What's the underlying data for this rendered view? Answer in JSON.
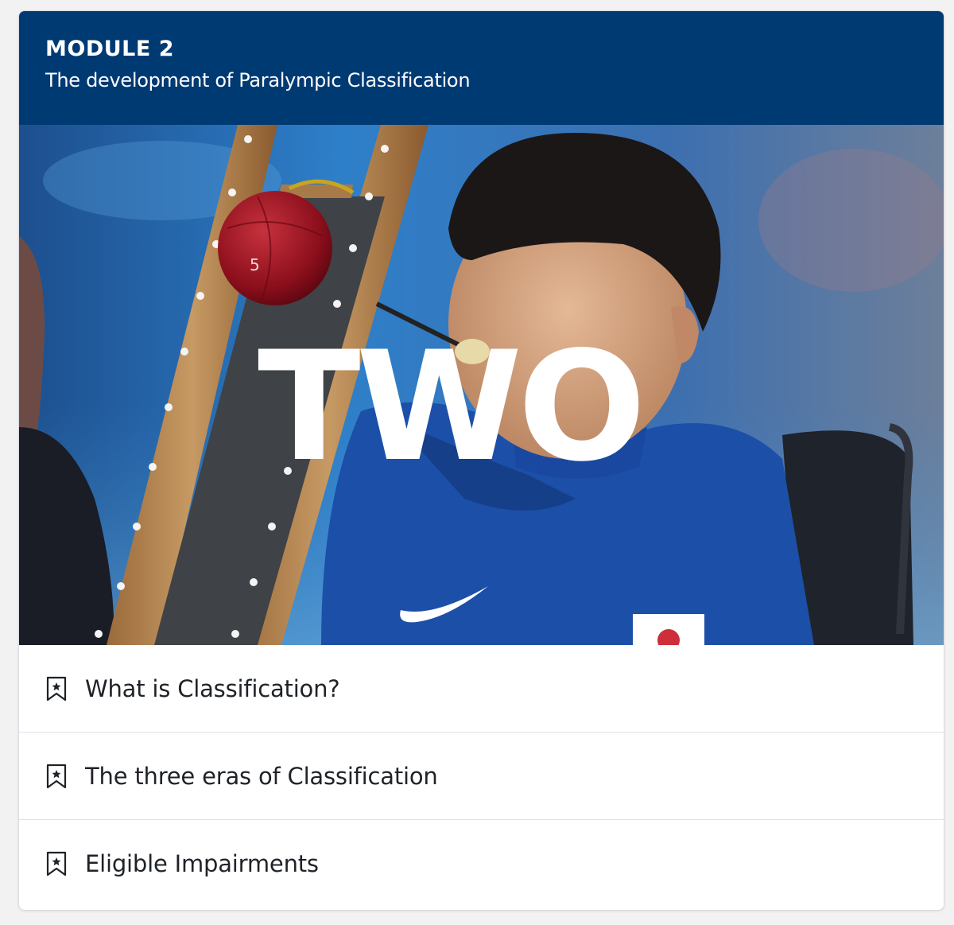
{
  "module": {
    "label": "MODULE 2",
    "subtitle": "The development of Paralympic Classification"
  },
  "hero": {
    "overlay_word": "TWO",
    "ball_number": "5",
    "header_color": "#003a73"
  },
  "lessons": [
    {
      "title": "What is Classification?",
      "icon": "bookmark-star-icon"
    },
    {
      "title": "The three eras of Classification",
      "icon": "bookmark-star-icon"
    },
    {
      "title": "Eligible Impairments",
      "icon": "bookmark-star-icon"
    }
  ]
}
